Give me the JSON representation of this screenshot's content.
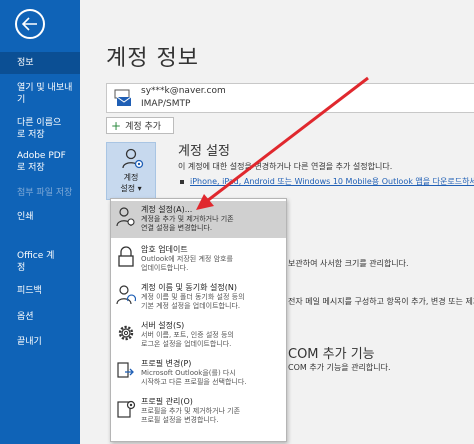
{
  "nav": {
    "items": [
      {
        "label": "정보"
      },
      {
        "label": "열기 및 내보내기"
      },
      {
        "label": "다른 이름으로 저장"
      },
      {
        "label": "Adobe PDF로 저장"
      },
      {
        "label": "첨부 파일 저장"
      },
      {
        "label": "인쇄"
      },
      {
        "label": "Office 계정"
      },
      {
        "label": "피드백"
      },
      {
        "label": "옵션"
      },
      {
        "label": "끝내기"
      }
    ]
  },
  "page": {
    "title": "계정 정보"
  },
  "account": {
    "email": "sy***k@naver.com",
    "type": "IMAP/SMTP"
  },
  "add_account": {
    "label": "계정 추가"
  },
  "settings_tile": {
    "line1": "계정",
    "line2": "설정 ▾"
  },
  "sections": {
    "account_settings": {
      "title": "계정 설정",
      "desc": "이 계정에 대한 설정을 변경하거나 다른 연결을 추가 설정합니다.",
      "link": "iPhone, iPad, Android 또는 Windows 10 Mobile용 Outlook 앱을 다운로드하세"
    },
    "mailbox": {
      "desc": "보관하여 사서함 크기를 관리합니다."
    },
    "rules": {
      "desc": "전자 메일 메시지를 구성하고 항목이 추가, 변경 또는 제거"
    },
    "com": {
      "title": "COM 추가 기능",
      "desc": "COM 추가 기능을 관리합니다."
    }
  },
  "dropdown": {
    "items": [
      {
        "title": "계정 설정(A)...",
        "desc1": "계정을 추가 및 제거하거나 기존",
        "desc2": "연결 설정을 변경합니다."
      },
      {
        "title": "암호 업데이트",
        "desc1": "Outlook에 저장된 계정 암호를",
        "desc2": "업데이트합니다."
      },
      {
        "title": "계정 이름 및 동기화 설정(N)",
        "desc1": "계정 이름 및 폴더 동기화 설정 등의",
        "desc2": "기본 계정 설정을 업데이트합니다."
      },
      {
        "title": "서버 설정(S)",
        "desc1": "서버 이름, 포트, 인증 설정 등의",
        "desc2": "로그온 설정을 업데이트합니다."
      },
      {
        "title": "프로필 변경(P)",
        "desc1": "Microsoft Outlook을(를) 다시",
        "desc2": "시작하고 다른 프로필을 선택합니다."
      },
      {
        "title": "프로필 관리(O)",
        "desc1": "프로필을 추가 및 제거하거나 기존",
        "desc2": "프로필 설정을 변경합니다."
      }
    ]
  },
  "colors": {
    "nav": "#0f63b7",
    "arrow": "#e0282e",
    "highlight": "#d0d0d0"
  }
}
